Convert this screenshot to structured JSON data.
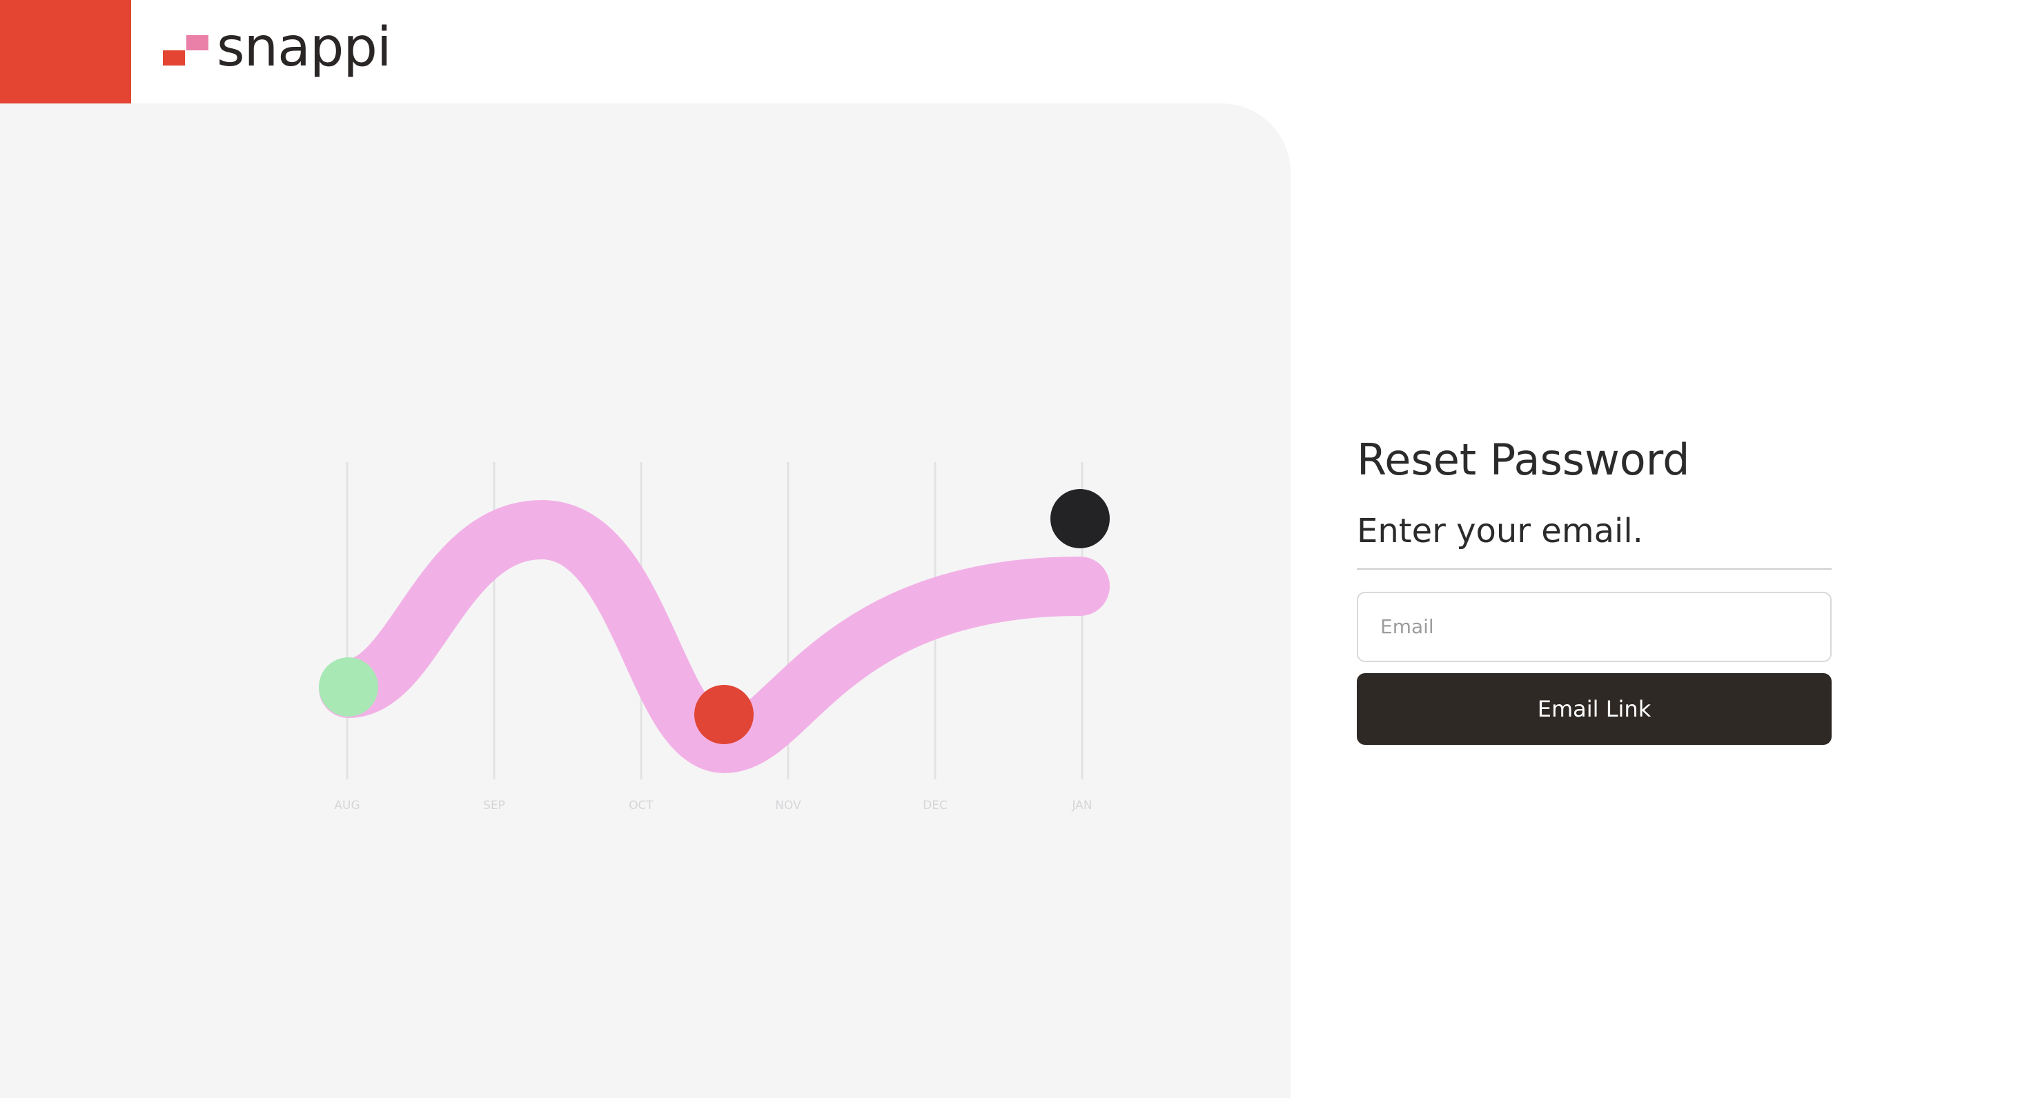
{
  "brand": {
    "name": "snappi",
    "colors": {
      "red": "#e34532",
      "pink": "#ea7fa7",
      "dark": "#2a2626"
    }
  },
  "illustration": {
    "months": [
      "AUG",
      "SEP",
      "OCT",
      "NOV",
      "DEC",
      "JAN"
    ],
    "colors": {
      "curve": "#f2b1e6",
      "start_dot": "#a8e8b4",
      "mid_dot": "#e14535",
      "end_dot": "#232325",
      "gridline": "#e2e2e4",
      "month_label": "#d6d6d8"
    }
  },
  "form": {
    "title": "Reset Password",
    "subtitle": "Enter your email.",
    "email_placeholder": "Email",
    "submit_label": "Email Link"
  }
}
